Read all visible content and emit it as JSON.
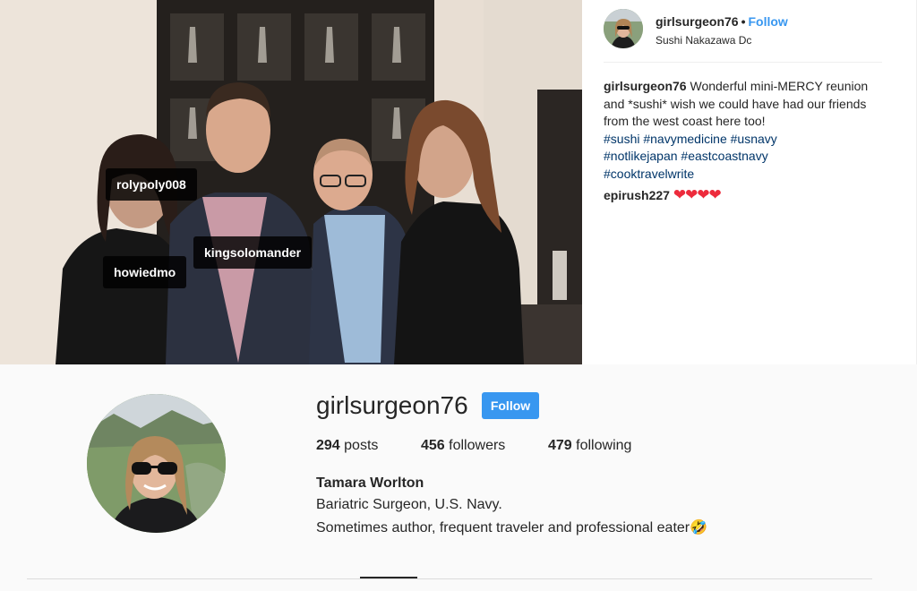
{
  "post": {
    "tags": [
      {
        "label": "rolypoly008"
      },
      {
        "label": "kingsolomander"
      },
      {
        "label": "howiedmo"
      }
    ],
    "header": {
      "username": "girlsurgeon76",
      "separator": "•",
      "follow_label": "Follow",
      "location": "Sushi Nakazawa Dc"
    },
    "caption": {
      "username": "girlsurgeon76",
      "text": "Wonderful mini-MERCY reunion and *sushi* wish we could have had our friends from the west coast here too!",
      "hashtags": [
        "#sushi",
        "#navymedicine",
        "#usnavy",
        "#notlikejapan",
        "#eastcoastnavy",
        "#cooktravelwrite"
      ]
    },
    "comment": {
      "username": "epirush227",
      "text": "❤❤❤❤"
    }
  },
  "profile": {
    "username": "girlsurgeon76",
    "follow_label": "Follow",
    "stats": [
      {
        "count": "294",
        "label": "posts"
      },
      {
        "count": "456",
        "label": "followers"
      },
      {
        "count": "479",
        "label": "following"
      }
    ],
    "full_name": "Tamara Worlton",
    "bio_line1": "Bariatric Surgeon, U.S. Navy.",
    "bio_line2": "Sometimes author, frequent traveler and professional eater🤣"
  },
  "colors": {
    "accent": "#3897f0",
    "hashtag": "#003569",
    "heart": "#ed2b3c"
  },
  "icons": {
    "hearts": "heart-emoji",
    "laugh": "rolling-laughing-emoji"
  }
}
